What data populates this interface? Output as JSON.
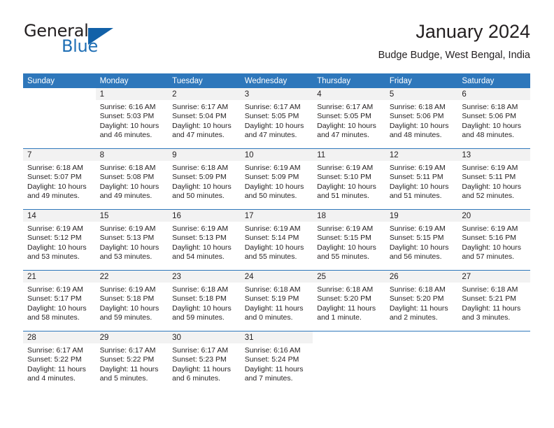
{
  "brand": {
    "name_part1": "General",
    "name_part2": "Blue"
  },
  "header": {
    "title": "January 2024",
    "subtitle": "Budge Budge, West Bengal, India"
  },
  "weekday_headers": [
    "Sunday",
    "Monday",
    "Tuesday",
    "Wednesday",
    "Thursday",
    "Friday",
    "Saturday"
  ],
  "colors": {
    "header_blue": "#2e77bb",
    "band_gray": "#f2f2f2",
    "text": "#231f20",
    "logo_blue": "#1261a8"
  },
  "weeks": [
    [
      {
        "day": "",
        "sunrise": "",
        "sunset": "",
        "daylight1": "",
        "daylight2": "",
        "blank": true
      },
      {
        "day": "1",
        "sunrise": "Sunrise: 6:16 AM",
        "sunset": "Sunset: 5:03 PM",
        "daylight1": "Daylight: 10 hours",
        "daylight2": "and 46 minutes."
      },
      {
        "day": "2",
        "sunrise": "Sunrise: 6:17 AM",
        "sunset": "Sunset: 5:04 PM",
        "daylight1": "Daylight: 10 hours",
        "daylight2": "and 47 minutes."
      },
      {
        "day": "3",
        "sunrise": "Sunrise: 6:17 AM",
        "sunset": "Sunset: 5:05 PM",
        "daylight1": "Daylight: 10 hours",
        "daylight2": "and 47 minutes."
      },
      {
        "day": "4",
        "sunrise": "Sunrise: 6:17 AM",
        "sunset": "Sunset: 5:05 PM",
        "daylight1": "Daylight: 10 hours",
        "daylight2": "and 47 minutes."
      },
      {
        "day": "5",
        "sunrise": "Sunrise: 6:18 AM",
        "sunset": "Sunset: 5:06 PM",
        "daylight1": "Daylight: 10 hours",
        "daylight2": "and 48 minutes."
      },
      {
        "day": "6",
        "sunrise": "Sunrise: 6:18 AM",
        "sunset": "Sunset: 5:06 PM",
        "daylight1": "Daylight: 10 hours",
        "daylight2": "and 48 minutes."
      }
    ],
    [
      {
        "day": "7",
        "sunrise": "Sunrise: 6:18 AM",
        "sunset": "Sunset: 5:07 PM",
        "daylight1": "Daylight: 10 hours",
        "daylight2": "and 49 minutes."
      },
      {
        "day": "8",
        "sunrise": "Sunrise: 6:18 AM",
        "sunset": "Sunset: 5:08 PM",
        "daylight1": "Daylight: 10 hours",
        "daylight2": "and 49 minutes."
      },
      {
        "day": "9",
        "sunrise": "Sunrise: 6:18 AM",
        "sunset": "Sunset: 5:09 PM",
        "daylight1": "Daylight: 10 hours",
        "daylight2": "and 50 minutes."
      },
      {
        "day": "10",
        "sunrise": "Sunrise: 6:19 AM",
        "sunset": "Sunset: 5:09 PM",
        "daylight1": "Daylight: 10 hours",
        "daylight2": "and 50 minutes."
      },
      {
        "day": "11",
        "sunrise": "Sunrise: 6:19 AM",
        "sunset": "Sunset: 5:10 PM",
        "daylight1": "Daylight: 10 hours",
        "daylight2": "and 51 minutes."
      },
      {
        "day": "12",
        "sunrise": "Sunrise: 6:19 AM",
        "sunset": "Sunset: 5:11 PM",
        "daylight1": "Daylight: 10 hours",
        "daylight2": "and 51 minutes."
      },
      {
        "day": "13",
        "sunrise": "Sunrise: 6:19 AM",
        "sunset": "Sunset: 5:11 PM",
        "daylight1": "Daylight: 10 hours",
        "daylight2": "and 52 minutes."
      }
    ],
    [
      {
        "day": "14",
        "sunrise": "Sunrise: 6:19 AM",
        "sunset": "Sunset: 5:12 PM",
        "daylight1": "Daylight: 10 hours",
        "daylight2": "and 53 minutes."
      },
      {
        "day": "15",
        "sunrise": "Sunrise: 6:19 AM",
        "sunset": "Sunset: 5:13 PM",
        "daylight1": "Daylight: 10 hours",
        "daylight2": "and 53 minutes."
      },
      {
        "day": "16",
        "sunrise": "Sunrise: 6:19 AM",
        "sunset": "Sunset: 5:13 PM",
        "daylight1": "Daylight: 10 hours",
        "daylight2": "and 54 minutes."
      },
      {
        "day": "17",
        "sunrise": "Sunrise: 6:19 AM",
        "sunset": "Sunset: 5:14 PM",
        "daylight1": "Daylight: 10 hours",
        "daylight2": "and 55 minutes."
      },
      {
        "day": "18",
        "sunrise": "Sunrise: 6:19 AM",
        "sunset": "Sunset: 5:15 PM",
        "daylight1": "Daylight: 10 hours",
        "daylight2": "and 55 minutes."
      },
      {
        "day": "19",
        "sunrise": "Sunrise: 6:19 AM",
        "sunset": "Sunset: 5:15 PM",
        "daylight1": "Daylight: 10 hours",
        "daylight2": "and 56 minutes."
      },
      {
        "day": "20",
        "sunrise": "Sunrise: 6:19 AM",
        "sunset": "Sunset: 5:16 PM",
        "daylight1": "Daylight: 10 hours",
        "daylight2": "and 57 minutes."
      }
    ],
    [
      {
        "day": "21",
        "sunrise": "Sunrise: 6:19 AM",
        "sunset": "Sunset: 5:17 PM",
        "daylight1": "Daylight: 10 hours",
        "daylight2": "and 58 minutes."
      },
      {
        "day": "22",
        "sunrise": "Sunrise: 6:19 AM",
        "sunset": "Sunset: 5:18 PM",
        "daylight1": "Daylight: 10 hours",
        "daylight2": "and 59 minutes."
      },
      {
        "day": "23",
        "sunrise": "Sunrise: 6:18 AM",
        "sunset": "Sunset: 5:18 PM",
        "daylight1": "Daylight: 10 hours",
        "daylight2": "and 59 minutes."
      },
      {
        "day": "24",
        "sunrise": "Sunrise: 6:18 AM",
        "sunset": "Sunset: 5:19 PM",
        "daylight1": "Daylight: 11 hours",
        "daylight2": "and 0 minutes."
      },
      {
        "day": "25",
        "sunrise": "Sunrise: 6:18 AM",
        "sunset": "Sunset: 5:20 PM",
        "daylight1": "Daylight: 11 hours",
        "daylight2": "and 1 minute."
      },
      {
        "day": "26",
        "sunrise": "Sunrise: 6:18 AM",
        "sunset": "Sunset: 5:20 PM",
        "daylight1": "Daylight: 11 hours",
        "daylight2": "and 2 minutes."
      },
      {
        "day": "27",
        "sunrise": "Sunrise: 6:18 AM",
        "sunset": "Sunset: 5:21 PM",
        "daylight1": "Daylight: 11 hours",
        "daylight2": "and 3 minutes."
      }
    ],
    [
      {
        "day": "28",
        "sunrise": "Sunrise: 6:17 AM",
        "sunset": "Sunset: 5:22 PM",
        "daylight1": "Daylight: 11 hours",
        "daylight2": "and 4 minutes."
      },
      {
        "day": "29",
        "sunrise": "Sunrise: 6:17 AM",
        "sunset": "Sunset: 5:22 PM",
        "daylight1": "Daylight: 11 hours",
        "daylight2": "and 5 minutes."
      },
      {
        "day": "30",
        "sunrise": "Sunrise: 6:17 AM",
        "sunset": "Sunset: 5:23 PM",
        "daylight1": "Daylight: 11 hours",
        "daylight2": "and 6 minutes."
      },
      {
        "day": "31",
        "sunrise": "Sunrise: 6:16 AM",
        "sunset": "Sunset: 5:24 PM",
        "daylight1": "Daylight: 11 hours",
        "daylight2": "and 7 minutes."
      },
      {
        "day": "",
        "sunrise": "",
        "sunset": "",
        "daylight1": "",
        "daylight2": "",
        "blank": true
      },
      {
        "day": "",
        "sunrise": "",
        "sunset": "",
        "daylight1": "",
        "daylight2": "",
        "blank": true
      },
      {
        "day": "",
        "sunrise": "",
        "sunset": "",
        "daylight1": "",
        "daylight2": "",
        "blank": true
      }
    ]
  ]
}
